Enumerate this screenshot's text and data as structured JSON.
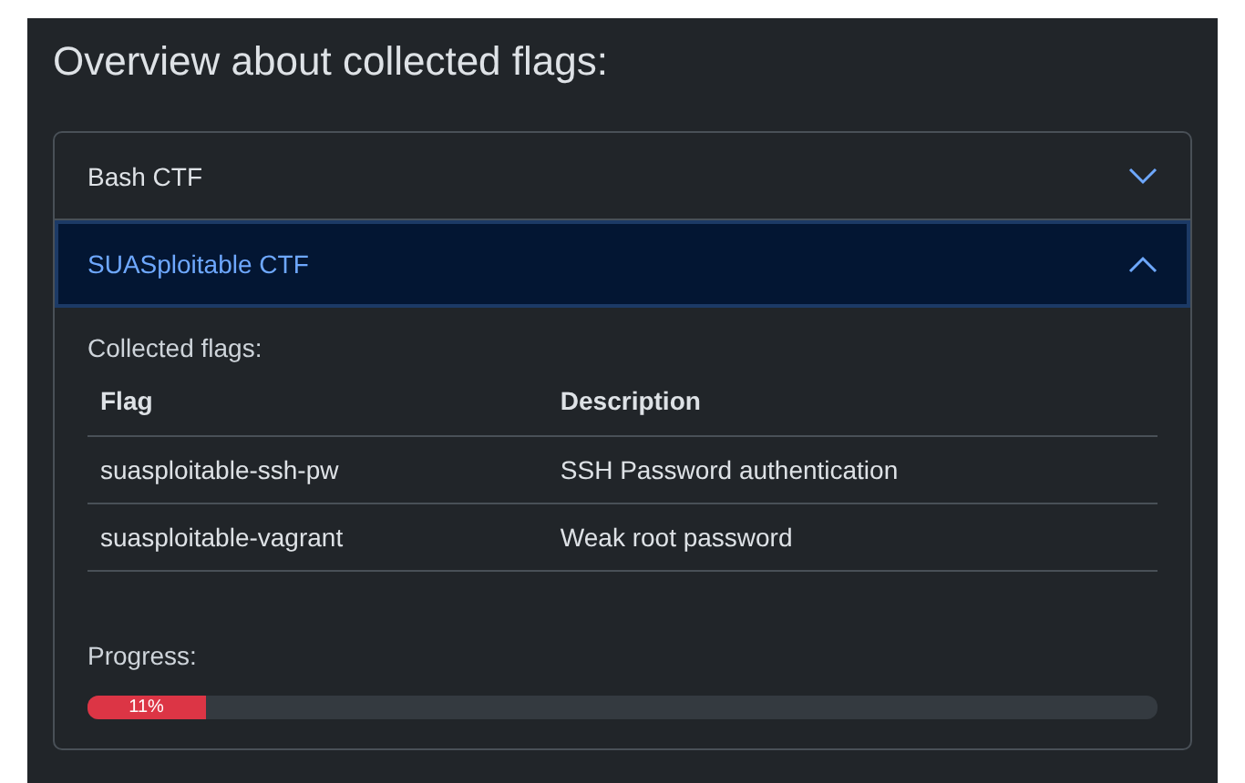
{
  "title": "Overview about collected flags:",
  "accordion": [
    {
      "title": "Bash CTF",
      "expanded": false
    },
    {
      "title": "SUASploitable CTF",
      "expanded": true,
      "collected_label": "Collected flags:",
      "table": {
        "columns": [
          "Flag",
          "Description"
        ],
        "rows": [
          [
            "suasploitable-ssh-pw",
            "SSH Password authentication"
          ],
          [
            "suasploitable-vagrant",
            "Weak root password"
          ]
        ]
      },
      "progress_label": "Progress:",
      "progress": {
        "level": 0.11,
        "reading": "11%"
      }
    }
  ]
}
